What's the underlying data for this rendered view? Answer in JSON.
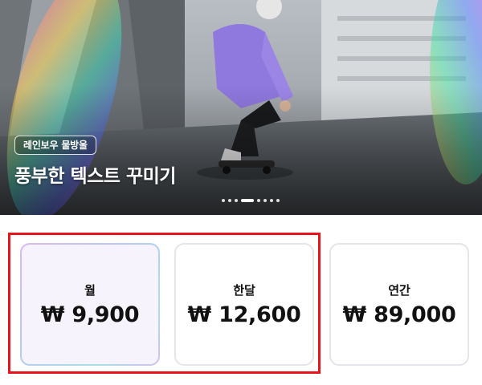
{
  "hero": {
    "tag": "레인보우 물방울",
    "title": "풍부한 텍스트 꾸미기",
    "pagination": {
      "count": 8,
      "active_index": 3
    }
  },
  "plans": [
    {
      "name": "월",
      "price": "₩ 9,900",
      "selected": true
    },
    {
      "name": "한달",
      "price": "₩ 12,600",
      "selected": false
    },
    {
      "name": "연간",
      "price": "₩ 89,000",
      "selected": false
    }
  ],
  "colors": {
    "highlight_border": "#e8131b",
    "selected_card_bg": "#f6f3fc",
    "card_border": "#e3e5e8"
  }
}
